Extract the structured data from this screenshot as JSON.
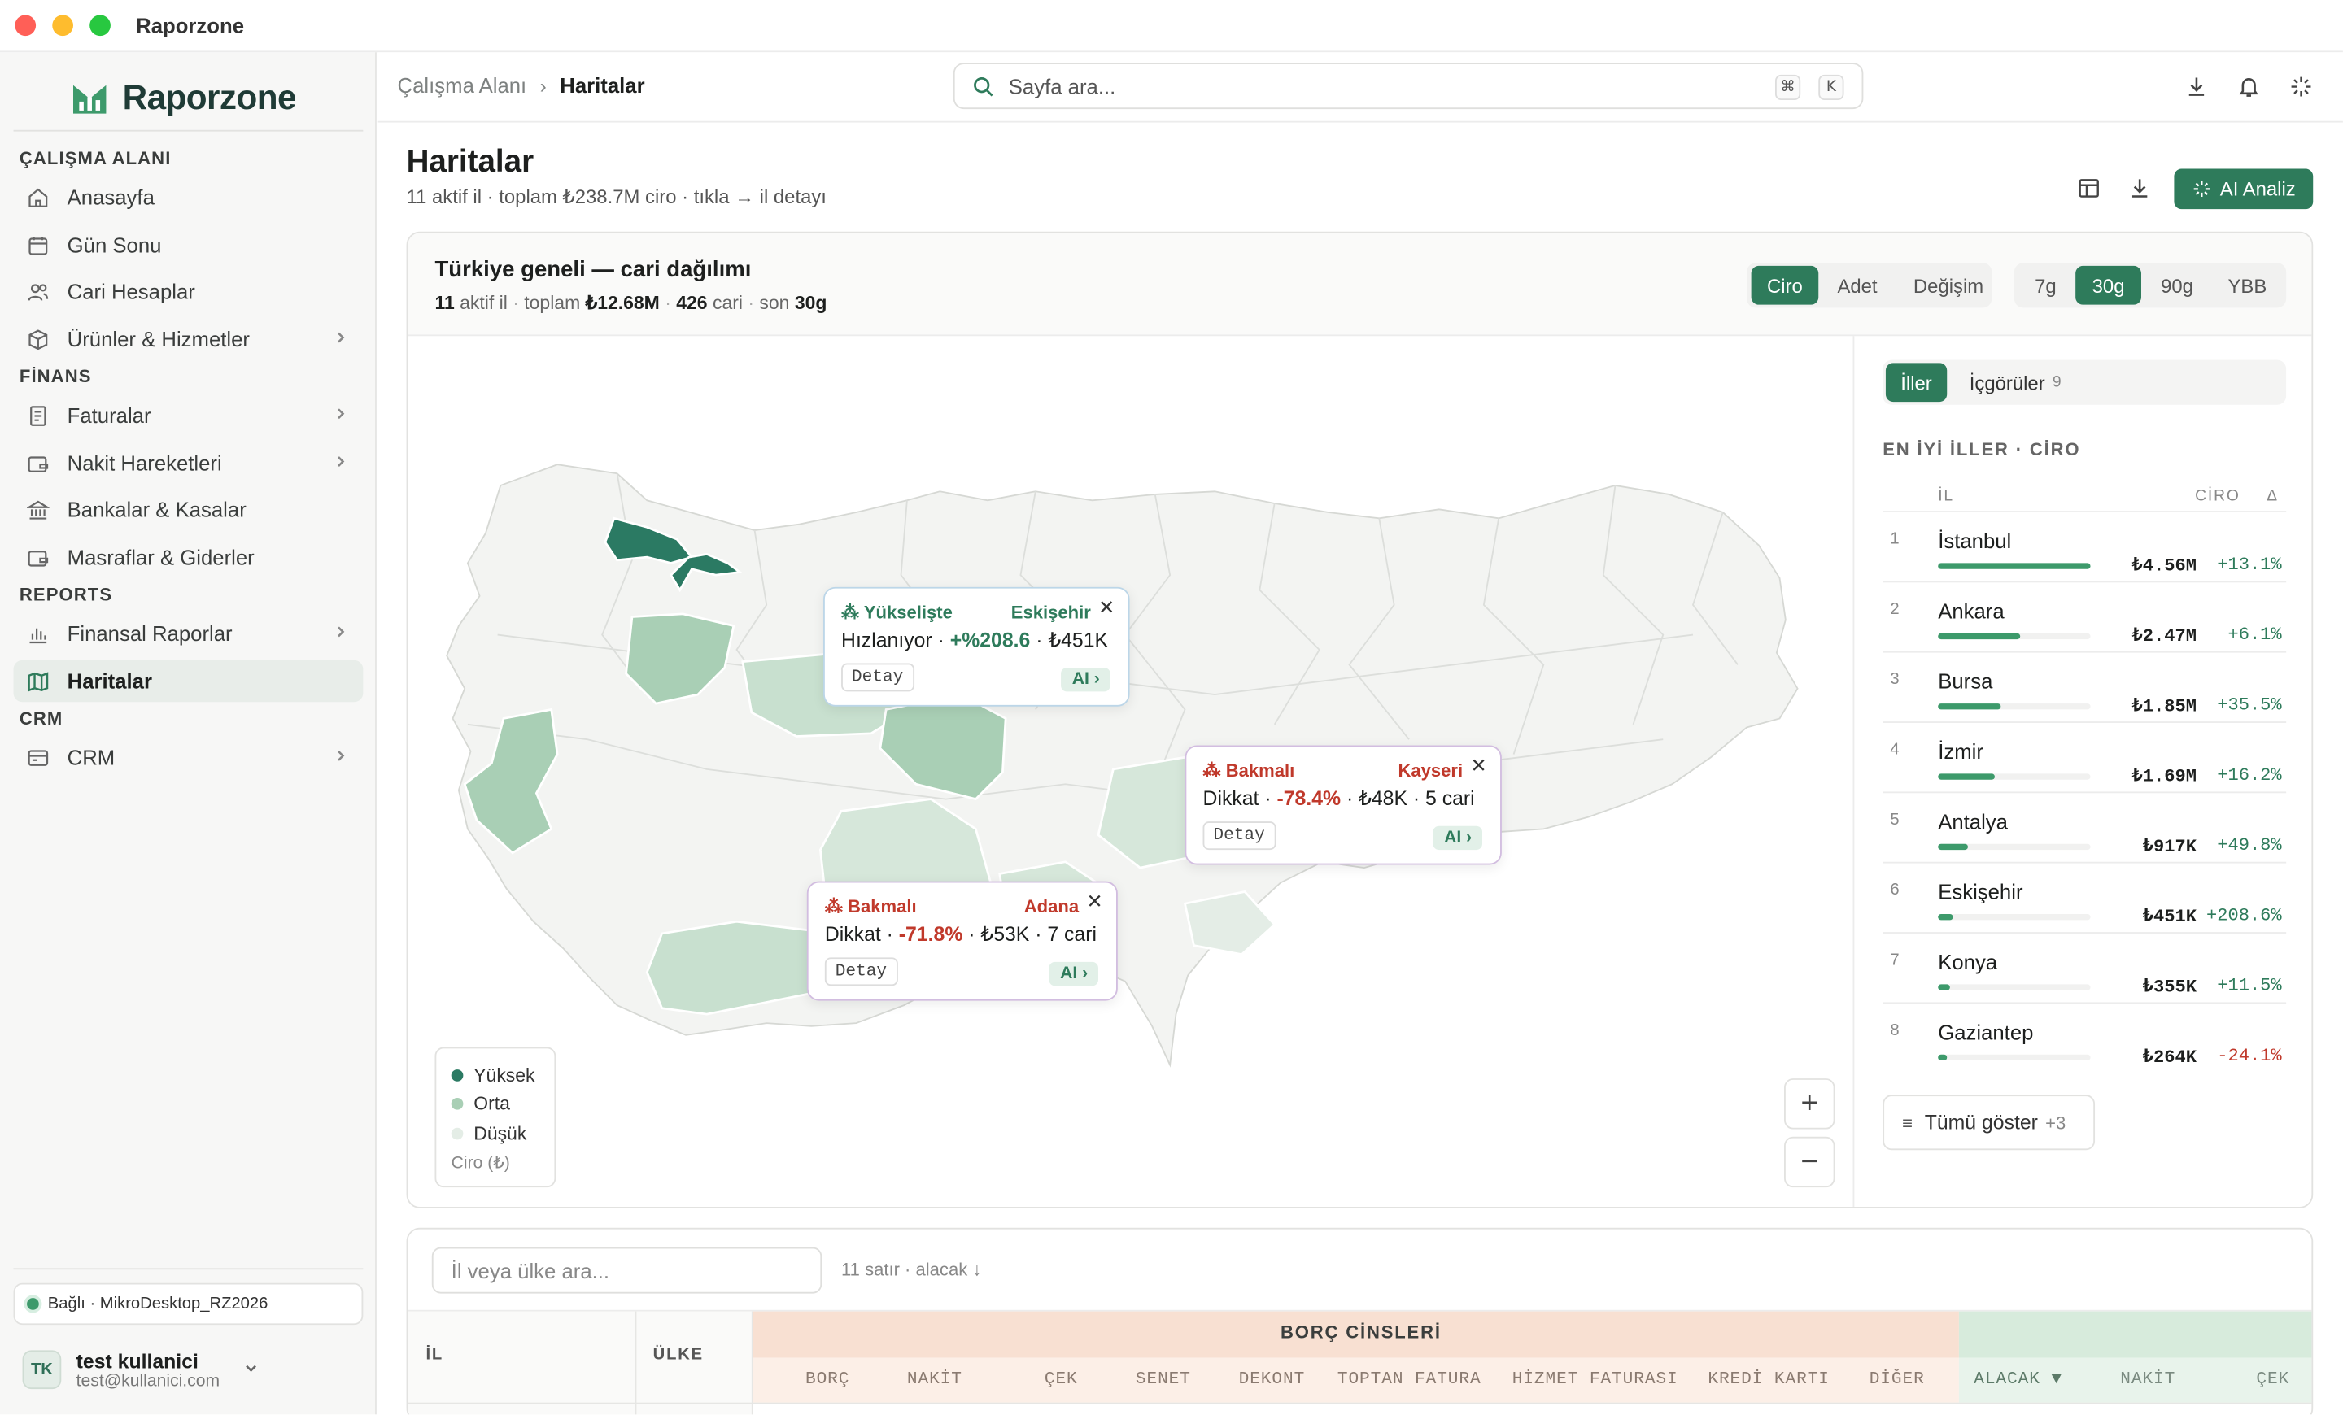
{
  "window": {
    "title": "Raporzone"
  },
  "sidebar": {
    "brand": "Raporzone",
    "sections": {
      "workspace": "ÇALIŞMA ALANI",
      "finance": "FİNANS",
      "reports": "REPORTS",
      "crm": "CRM"
    },
    "items": [
      {
        "label": "Anasayfa"
      },
      {
        "label": "Gün Sonu"
      },
      {
        "label": "Cari Hesaplar"
      },
      {
        "label": "Ürünler & Hizmetler"
      },
      {
        "label": "Faturalar"
      },
      {
        "label": "Nakit Hareketleri"
      },
      {
        "label": "Bankalar & Kasalar"
      },
      {
        "label": "Masraflar & Giderler"
      },
      {
        "label": "Finansal Raporlar"
      },
      {
        "label": "Haritalar"
      },
      {
        "label": "CRM"
      }
    ],
    "connection": "Bağlı · MikroDesktop_RZ2026",
    "user": {
      "initials": "TK",
      "name": "test kullanici",
      "email": "test@kullanici.com"
    }
  },
  "topbar": {
    "breadcrumb": [
      "Çalışma Alanı",
      "Haritalar"
    ],
    "search_placeholder": "Sayfa ara...",
    "kbd": [
      "⌘",
      "K"
    ]
  },
  "page": {
    "title": "Haritalar",
    "subtitle": "11 aktif il · toplam ₺238.7M ciro · tıkla → il detayı",
    "ai_button": "AI Analiz"
  },
  "map_card": {
    "title": "Türkiye geneli — cari dağılımı",
    "stats": {
      "active": "11",
      "active_label": "aktif il",
      "total_label": "toplam",
      "total": "₺12.68M",
      "cari": "426",
      "cari_label": "cari",
      "last_label": "son",
      "last": "30g"
    },
    "metric_tabs": [
      "Ciro",
      "Adet",
      "Değişim"
    ],
    "metric_selected": "Ciro",
    "period_tabs": [
      "7g",
      "30g",
      "90g",
      "YBB"
    ],
    "period_selected": "30g",
    "popups": [
      {
        "tag": "Yükselişte",
        "city": "Eskişehir",
        "text": "Hızlanıyor · ",
        "delta": "+%208.6",
        "rest": " · ₺451K",
        "detail": "Detay",
        "ai": "AI ›",
        "color": "#2e7b5b"
      },
      {
        "tag": "Bakmalı",
        "city": "Kayseri",
        "text": "Dikkat · ",
        "delta": "-78.4%",
        "rest": " · ₺48K · 5 cari",
        "detail": "Detay",
        "ai": "AI ›",
        "color": "#c0392b"
      },
      {
        "tag": "Bakmalı",
        "city": "Adana",
        "text": "Dikkat · ",
        "delta": "-71.8%",
        "rest": " · ₺53K · 7 cari",
        "detail": "Detay",
        "ai": "AI ›",
        "color": "#c0392b"
      }
    ],
    "legend": {
      "items": [
        "Yüksek",
        "Orta",
        "Düşük"
      ],
      "unit": "Ciro (₺)",
      "colors": [
        "#2b7a63",
        "#a9cfb5",
        "#e4ede6"
      ]
    },
    "zoom": {
      "in": "+",
      "out": "−"
    }
  },
  "right_panel": {
    "tabs": [
      {
        "label": "İller"
      },
      {
        "label": "İçgörüler",
        "count": "9"
      }
    ],
    "section_title": "EN İYİ İLLER · CİRO",
    "headers": {
      "il": "İL",
      "ciro": "CİRO",
      "delta": "Δ"
    },
    "rows": [
      {
        "rank": "1",
        "name": "İstanbul",
        "value": "₺4.56M",
        "delta": "+13.1%",
        "share": 1.0
      },
      {
        "rank": "2",
        "name": "Ankara",
        "value": "₺2.47M",
        "delta": "+6.1%",
        "share": 0.54
      },
      {
        "rank": "3",
        "name": "Bursa",
        "value": "₺1.85M",
        "delta": "+35.5%",
        "share": 0.41
      },
      {
        "rank": "4",
        "name": "İzmir",
        "value": "₺1.69M",
        "delta": "+16.2%",
        "share": 0.37
      },
      {
        "rank": "5",
        "name": "Antalya",
        "value": "₺917K",
        "delta": "+49.8%",
        "share": 0.2
      },
      {
        "rank": "6",
        "name": "Eskişehir",
        "value": "₺451K",
        "delta": "+208.6%",
        "share": 0.1
      },
      {
        "rank": "7",
        "name": "Konya",
        "value": "₺355K",
        "delta": "+11.5%",
        "share": 0.08
      },
      {
        "rank": "8",
        "name": "Gaziantep",
        "value": "₺264K",
        "delta": "-24.1%",
        "share": 0.06
      }
    ],
    "show_all": "Tümü göster",
    "show_all_count": "+3"
  },
  "table": {
    "search_placeholder": "İl veya ülke ara...",
    "info": "11 satır · alacak ↓",
    "col_il": "İL",
    "col_ulke": "ÜLKE",
    "group_borc": "BORÇ CİNSLERİ",
    "borc_cols": [
      "BORÇ",
      "NAKİT",
      "ÇEK",
      "SENET",
      "DEKONT",
      "TOPTAN FATURA",
      "HİZMET FATURASI",
      "KREDİ KARTI",
      "DİĞER"
    ],
    "alacak_cols": [
      "ALACAK ▼",
      "NAKİT",
      "ÇEK"
    ]
  }
}
